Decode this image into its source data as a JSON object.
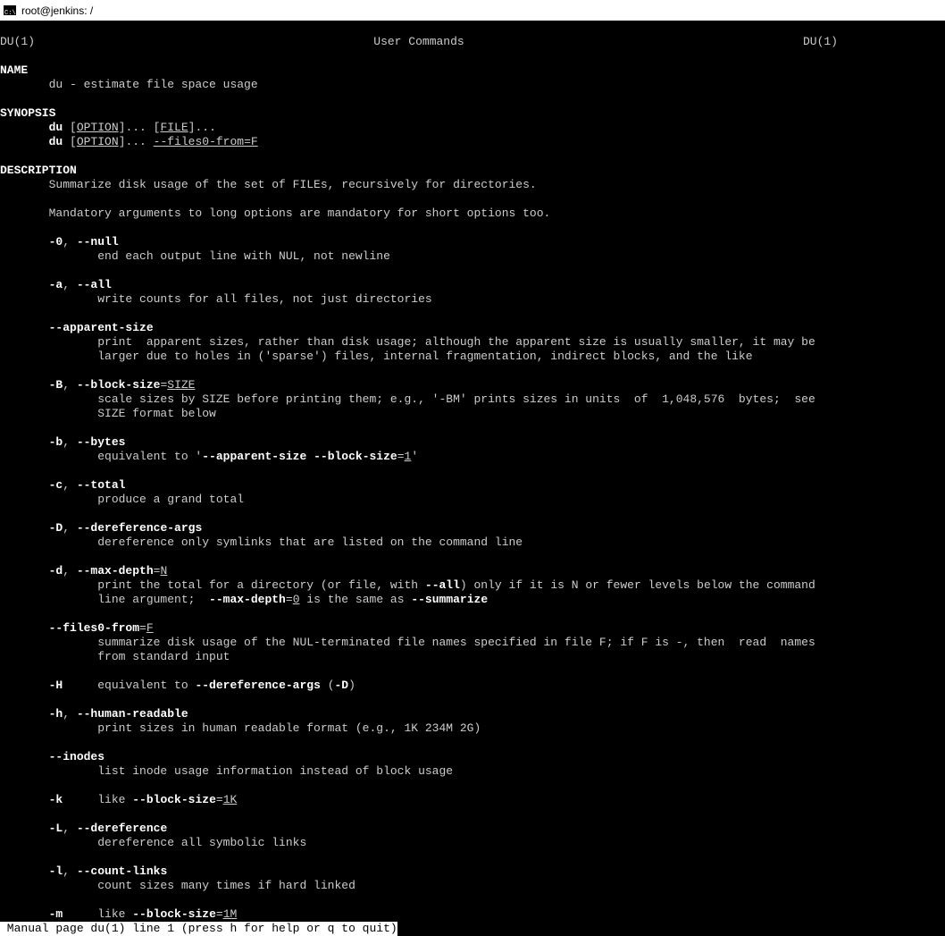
{
  "window": {
    "title": "root@jenkins: /"
  },
  "header": {
    "left": "DU(1)",
    "center": "User Commands",
    "right": "DU(1)"
  },
  "sections": {
    "name_hdr": "NAME",
    "name_line": "du - estimate file space usage",
    "synopsis_hdr": "SYNOPSIS",
    "syn1_cmd": "du",
    "syn1_opt": "OPTION",
    "syn1_file": "FILE",
    "syn2_cmd": "du",
    "syn2_opt": "OPTION",
    "syn2_files0": "--files0-from=F",
    "desc_hdr": "DESCRIPTION",
    "desc_p1": "Summarize disk usage of the set of FILEs, recursively for directories.",
    "desc_p2": "Mandatory arguments to long options are mandatory for short options too."
  },
  "opts": {
    "o0_flag": "-0",
    "o0_long": "--null",
    "o0_desc": "end each output line with NUL, not newline",
    "oa_flag": "-a",
    "oa_long": "--all",
    "oa_desc": "write counts for all files, not just directories",
    "oapp_long": "--apparent-size",
    "oapp_d1": "print  apparent sizes, rather than disk usage; although the apparent size is usually smaller, it may be",
    "oapp_d2": "larger due to holes in ('sparse') files, internal fragmentation, indirect blocks, and the like",
    "oB_flag": "-B",
    "oB_long": "--block-size",
    "oB_arg": "SIZE",
    "oB_d1": "scale sizes by SIZE before printing them; e.g., '-BM' prints sizes in units  of  1,048,576  bytes;  see",
    "oB_d2": "SIZE format below",
    "ob_flag": "-b",
    "ob_long": "--bytes",
    "ob_pre": "equivalent to '",
    "ob_bold1": "--apparent-size",
    "ob_mid": " ",
    "ob_bold2": "--block-size",
    "ob_eq": "=",
    "ob_arg": "1",
    "ob_post": "'",
    "oc_flag": "-c",
    "oc_long": "--total",
    "oc_desc": "produce a grand total",
    "oD_flag": "-D",
    "oD_long": "--dereference-args",
    "oD_desc": "dereference only symlinks that are listed on the command line",
    "od_flag": "-d",
    "od_long": "--max-depth",
    "od_arg": "N",
    "od_d1a": "print the total for a directory (or file, with ",
    "od_d1b": "--all",
    "od_d1c": ") only if it is N or fewer levels below the command",
    "od_d2a": "line argument;  ",
    "od_d2b": "--max-depth",
    "od_d2eq": "=",
    "od_d2arg": "0",
    "od_d2c": " is the same as ",
    "od_d2d": "--summarize",
    "of0_long": "--files0-from",
    "of0_arg": "F",
    "of0_d1": "summarize disk usage of the NUL-terminated file names specified in file F; if F is -, then  read  names",
    "of0_d2": "from standard input",
    "oH_flag": "-H",
    "oH_pre": "equivalent to ",
    "oH_bold": "--dereference-args",
    "oH_post": " (",
    "oH_bold2": "-D",
    "oH_post2": ")",
    "oh_flag": "-h",
    "oh_long": "--human-readable",
    "oh_desc": "print sizes in human readable format (e.g., 1K 234M 2G)",
    "oin_long": "--inodes",
    "oin_desc": "list inode usage information instead of block usage",
    "ok_flag": "-k",
    "ok_pre": "like ",
    "ok_bold": "--block-size",
    "ok_eq": "=",
    "ok_arg": "1K",
    "oL_flag": "-L",
    "oL_long": "--dereference",
    "oL_desc": "dereference all symbolic links",
    "ol_flag": "-l",
    "ol_long": "--count-links",
    "ol_desc": "count sizes many times if hard linked",
    "om_flag": "-m",
    "om_pre": "like ",
    "om_bold": "--block-size",
    "om_eq": "=",
    "om_arg": "1M"
  },
  "status": " Manual page du(1) line 1 (press h for help or q to quit)"
}
